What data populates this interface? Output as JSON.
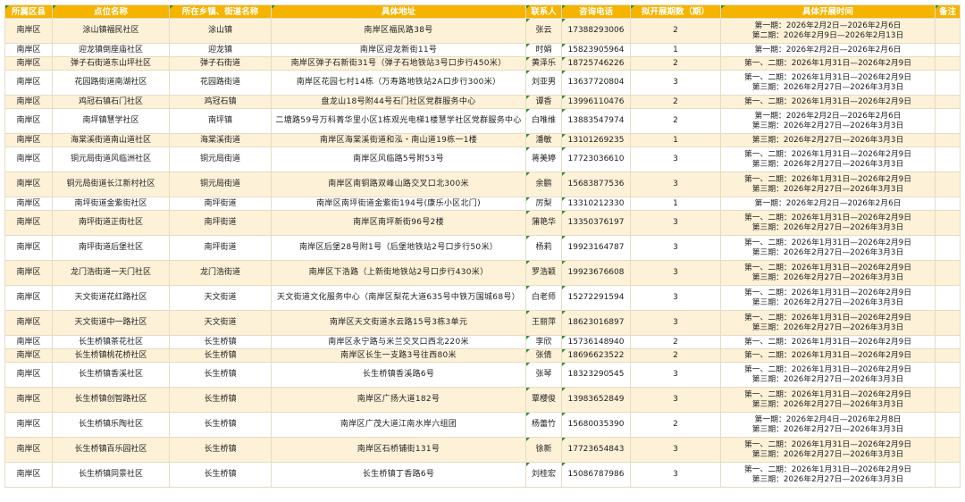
{
  "table": {
    "headers": [
      "所属区县",
      "点位名称",
      "所在乡镇、街道名称",
      "具体地址",
      "联系人",
      "咨询电话",
      "拟开展期数（期）",
      "具体开展时间",
      "备注"
    ],
    "rows": [
      {
        "district": "南岸区",
        "site": "涂山镇福民社区",
        "town": "涂山镇",
        "address": "南岸区福民路38号",
        "contact": "张云",
        "phone": "17388293006",
        "count": "2",
        "periods": [
          "第一期：2026年2月2日—2026年2月6日",
          "第二期：2026年2月9日—2026年2月13日"
        ],
        "note": ""
      },
      {
        "district": "南岸区",
        "site": "迎龙镇倒座庙社区",
        "town": "迎龙镇",
        "address": "南岸区迎龙新街11号",
        "contact": "时娟",
        "phone": "15823905964",
        "count": "1",
        "periods": [
          "第一期：2026年2月2日—2026年2月6日"
        ],
        "note": ""
      },
      {
        "district": "南岸区",
        "site": "弹子石街道东山坪社区",
        "town": "弹子石街道",
        "address": "南岸区弹子石新街31号（弹子石地铁站3号口步行450米）",
        "contact": "黄泽乐",
        "phone": "18725746226",
        "count": "2",
        "periods": [
          "第一、二期：2026年1月31日—2026年2月9日"
        ],
        "note": ""
      },
      {
        "district": "南岸区",
        "site": "花园路街道南湖社区",
        "town": "花园路街道",
        "address": "南岸区花园七村14栋（万寿路地铁站2A口步行300米）",
        "contact": "刘亚男",
        "phone": "13637720804",
        "count": "3",
        "periods": [
          "第一、二期：2026年1月31日—2026年2月9日",
          "第三期：2026年2月27日—2026年3月3日"
        ],
        "note": ""
      },
      {
        "district": "南岸区",
        "site": "鸡冠石镇石门社区",
        "town": "鸡冠石镇",
        "address": "盘龙山18号附44号石门社区党群服务中心",
        "contact": "谭香",
        "phone": "13996110476",
        "count": "2",
        "periods": [
          "第一、二期：2026年1月31日—2026年2月9日"
        ],
        "note": ""
      },
      {
        "district": "南岸区",
        "site": "南坪镇慧学社区",
        "town": "南坪镇",
        "address": "二塘路59号万科菁华里小区1栋观光电梯1楼慧学社区党群服务中心",
        "contact": "白唯维",
        "phone": "13883547974",
        "count": "2",
        "periods": [
          "第一期：2026年2月2日—2026年2月6日",
          "第三期：2026年2月27日—2026年3月3日"
        ],
        "note": ""
      },
      {
        "district": "南岸区",
        "site": "海棠溪街道南山道社区",
        "town": "海棠溪街道",
        "address": "南岸区海棠溪街道和泓・南山道19栋一1楼",
        "contact": "潘敏",
        "phone": "13101269235",
        "count": "1",
        "periods": [
          "第三期：2026年2月27日—2026年3月3日"
        ],
        "note": ""
      },
      {
        "district": "南岸区",
        "site": "铜元局街道风临洲社区",
        "town": "铜元局街道",
        "address": "南岸区风临路5号附53号",
        "contact": "蒋美婷",
        "phone": "17723036610",
        "count": "3",
        "periods": [
          "第一、二期：2026年1月31日—2026年2月9日",
          "第三期：2026年2月27日—2026年3月3日"
        ],
        "note": ""
      },
      {
        "district": "南岸区",
        "site": "铜元局街道长江新村社区",
        "town": "铜元局街道",
        "address": "南岸区南铜路双峰山路交叉口北300米",
        "contact": "余鹏",
        "phone": "15683877536",
        "count": "3",
        "periods": [
          "第一、二期：2026年1月31日—2026年2月9日",
          "第三期：2026年2月27日—2026年3月3日"
        ],
        "note": ""
      },
      {
        "district": "南岸区",
        "site": "南坪街道金紫街社区",
        "town": "南坪街道",
        "address": "南岸区南坪街道金紫街194号(康乐小区北门)",
        "contact": "厉梨",
        "phone": "13310212330",
        "count": "1",
        "periods": [
          "第一期：2026年2月2日—2026年2月6日"
        ],
        "note": ""
      },
      {
        "district": "南岸区",
        "site": "南坪街道正街社区",
        "town": "南坪街道",
        "address": "南岸区南坪新街96号2楼",
        "contact": "蒲艳华",
        "phone": "13350376197",
        "count": "3",
        "periods": [
          "第一、二期：2026年1月31日—2026年2月9日",
          "第三期：2026年2月27日—2026年3月3日"
        ],
        "note": ""
      },
      {
        "district": "南岸区",
        "site": "南坪街道后堡社区",
        "town": "南坪街道",
        "address": "南岸区后堡28号附1号（后堡地铁站2号口步行50米）",
        "contact": "杨莉",
        "phone": "19923164787",
        "count": "3",
        "periods": [
          "第一、二期：2026年1月31日—2026年2月9日",
          "第三期：2026年2月27日—2026年3月3日"
        ],
        "note": ""
      },
      {
        "district": "南岸区",
        "site": "龙门浩街道一天门社区",
        "town": "龙门浩街道",
        "address": "南岸区下浩路（上新街地铁站2号口步行430米）",
        "contact": "罗浩颖",
        "phone": "19923676608",
        "count": "3",
        "periods": [
          "第一、二期：2026年1月31日—2026年2月9日",
          "第三期：2026年2月27日—2026年3月3日"
        ],
        "note": ""
      },
      {
        "district": "南岸区",
        "site": "天文街道花红路社区",
        "town": "天文街道",
        "address": "天文街道文化服务中心（南岸区梨花大道635号中铁万国城68号）",
        "contact": "白老师",
        "phone": "15272291594",
        "count": "3",
        "periods": [
          "第一、二期：2026年1月31日—2026年2月9日",
          "第三期：2026年2月27日—2026年3月3日"
        ],
        "note": ""
      },
      {
        "district": "南岸区",
        "site": "天文街道中一路社区",
        "town": "天文街道",
        "address": "南岸区天文街道水云路15号3栋3单元",
        "contact": "王丽萍",
        "phone": "18623016897",
        "count": "3",
        "periods": [
          "第一、二期：2026年1月31日—2026年2月9日",
          "第三期：2026年2月27日—2026年3月3日"
        ],
        "note": ""
      },
      {
        "district": "南岸区",
        "site": "长生桥镇茶花社区",
        "town": "长生桥镇",
        "address": "南岸区永宁路与米兰交叉口西北220米",
        "contact": "李欣",
        "phone": "15736148940",
        "count": "2",
        "periods": [
          "第一、二期：2026年1月31日—2026年2月9日"
        ],
        "note": ""
      },
      {
        "district": "南岸区",
        "site": "长生桥镇桃花桥社区",
        "town": "长生桥镇",
        "address": "南岸区长生一支路3号往西80米",
        "contact": "张倩",
        "phone": "18696623522",
        "count": "2",
        "periods": [
          "第一、二期：2026年1月31日—2026年2月9日"
        ],
        "note": ""
      },
      {
        "district": "南岸区",
        "site": "长生桥镇香溪社区",
        "town": "长生桥镇",
        "address": "长生桥镇香溪路6号",
        "contact": "张琴",
        "phone": "18323290545",
        "count": "3",
        "periods": [
          "第一、二期：2026年1月31日—2026年2月9日",
          "第三期：2026年2月27日—2026年3月3日"
        ],
        "note": ""
      },
      {
        "district": "南岸区",
        "site": "长生桥镇创智路社区",
        "town": "长生桥镇",
        "address": "南岸区广扬大道182号",
        "contact": "覃櫻俊",
        "phone": "13983652849",
        "count": "3",
        "periods": [
          "第一、二期：2026年1月31日—2026年2月9日",
          "第三期：2026年2月27日—2026年3月3日"
        ],
        "note": ""
      },
      {
        "district": "南岸区",
        "site": "长生桥镇乐陶社区",
        "town": "长生桥镇",
        "address": "南岸区广茂大道江南水岸六组团",
        "contact": "杨蕾竹",
        "phone": "15680035390",
        "count": "2",
        "periods": [
          "第一期：2026年2月4日—2026年2月8日",
          "第三期：2026年2月27日—2026年3月3日"
        ],
        "note": ""
      },
      {
        "district": "南岸区",
        "site": "长生桥镇百乐园社区",
        "town": "长生桥镇",
        "address": "南岸区石桥铺街131号",
        "contact": "徐新",
        "phone": "17723654843",
        "count": "3",
        "periods": [
          "第一、二期：2026年1月31日—2026年2月9日",
          "第三期：2026年2月27日—2026年3月3日"
        ],
        "note": ""
      },
      {
        "district": "南岸区",
        "site": "长生桥镇同景社区",
        "town": "长生桥镇",
        "address": "长生桥镇丁香路6号",
        "contact": "刘桂宏",
        "phone": "15086787986",
        "count": "3",
        "periods": [
          "第一、二期：2026年1月31日—2026年2月9日",
          "第三期：2026年2月27日—2026年3月3日"
        ],
        "note": ""
      }
    ]
  },
  "colors": {
    "header_bg": "#f5b400",
    "header_text": "#ffffff",
    "row_alt": "#fdf1d8",
    "row": "#ffffff",
    "grid": "#e6dcc4",
    "corner_mark": "#2f8f3a"
  }
}
